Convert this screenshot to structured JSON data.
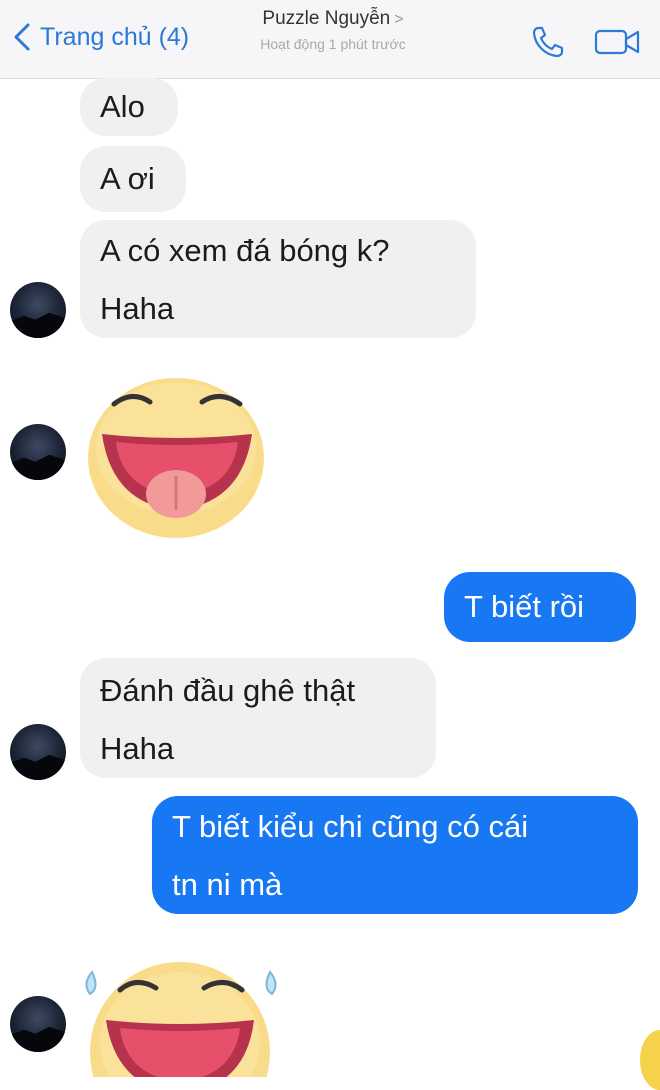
{
  "header": {
    "back_label": "Trang chủ (4)",
    "contact_name": "Puzzle Nguyễn",
    "name_arrow": ">",
    "status": "Hoạt động 1 phút trước"
  },
  "messages": [
    {
      "side": "in",
      "text": "Alo"
    },
    {
      "side": "in",
      "text": "A ơi"
    },
    {
      "side": "in",
      "lines": [
        "A có xem đá bóng k?",
        "Haha"
      ]
    },
    {
      "side": "in",
      "sticker": "laughing-tongue-emoji-sticker"
    },
    {
      "side": "out",
      "text": "T biết rồi"
    },
    {
      "side": "in",
      "lines": [
        "Đánh đầu ghê thật",
        "Haha"
      ]
    },
    {
      "side": "out",
      "lines": [
        "T biết kiểu chi cũng có cái",
        "tn ni mà"
      ]
    },
    {
      "side": "in",
      "sticker": "laughing-tears-emoji-sticker"
    }
  ],
  "colors": {
    "accent": "#2b7ad8",
    "outgoing_bubble": "#1877f2",
    "incoming_bubble": "#f0f0f0",
    "header_bg": "#f6f6f8"
  }
}
